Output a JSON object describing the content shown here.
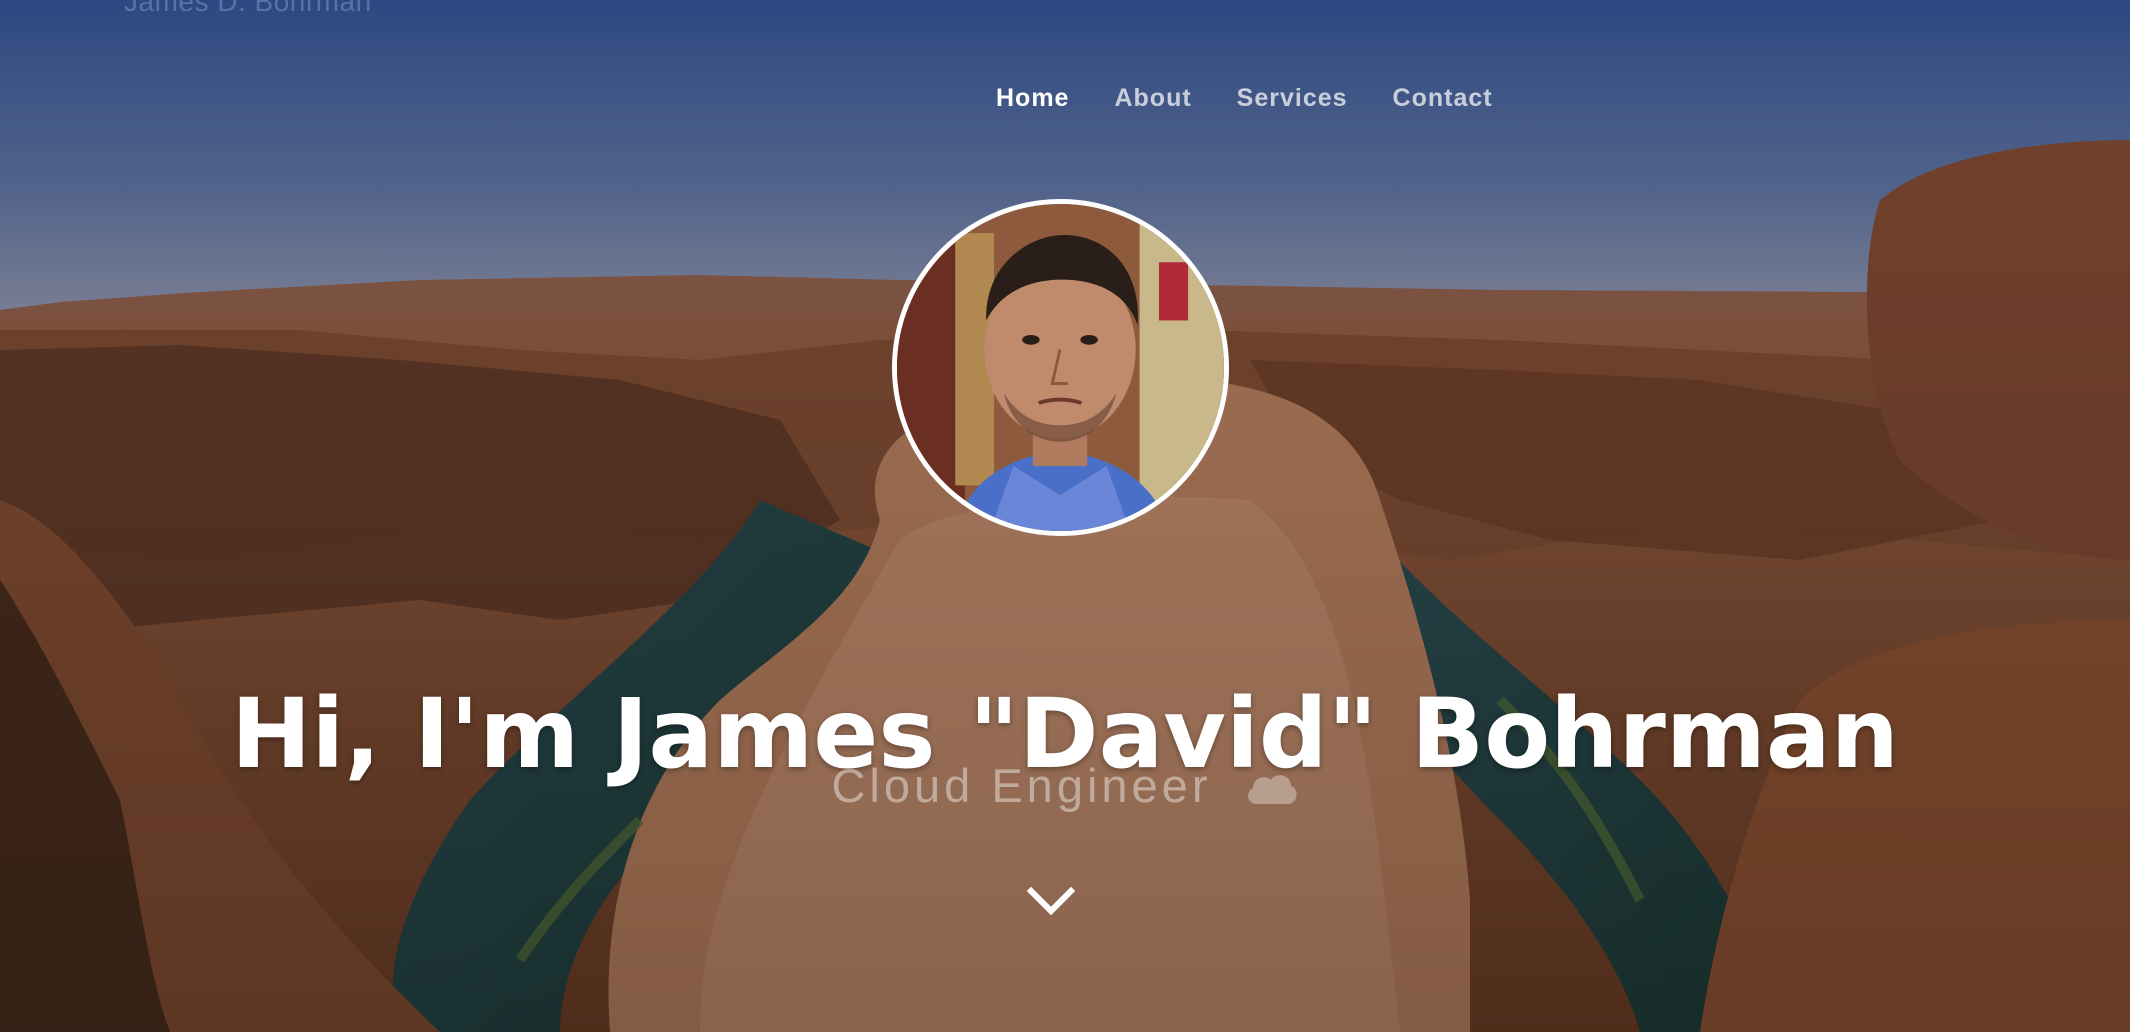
{
  "brand": {
    "name": "James D. Bohrman"
  },
  "nav": {
    "items": [
      {
        "label": "Home",
        "active": true
      },
      {
        "label": "About",
        "active": false
      },
      {
        "label": "Services",
        "active": false
      },
      {
        "label": "Contact",
        "active": false
      }
    ]
  },
  "hero": {
    "headline": "Hi, I'm James \"David\" Bohrman",
    "subtitle": "Cloud Engineer",
    "subtitle_icon": "cloud-icon",
    "scroll_icon": "chevron-down-icon",
    "background": "canyon-landscape-photo"
  },
  "colors": {
    "sky_top": "#2f4f8a",
    "sky_bottom": "#7a88a8",
    "rock": "#9a5a38",
    "text": "#ffffff"
  }
}
